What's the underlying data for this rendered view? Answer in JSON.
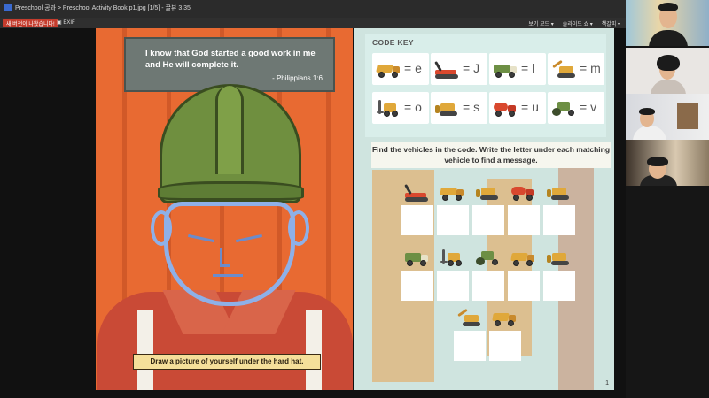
{
  "titlebar": {
    "text": "Preschool 공과 > Preschool Activity Book p1.jpg [1/5] - 꿀뷰 3.35"
  },
  "toolbar": {
    "prev_label": "새 버전이 나왔습니다!",
    "exif_label": "EXIF",
    "menu_view": "보기 모드 ▾",
    "menu_slide": "슬라이드 쇼 ▾",
    "menu_bookmark": "책갈피 ▾"
  },
  "left_page": {
    "verse_text": "I know that God started a good work in me and He will complete it.",
    "verse_ref": "- Philippians 1:6",
    "caption": "Draw a picture of yourself under the hard hat."
  },
  "right_page": {
    "code_key_title": "CODE KEY",
    "keys": [
      {
        "vehicle": "dump-truck",
        "letter": "= e"
      },
      {
        "vehicle": "crane",
        "letter": "= J"
      },
      {
        "vehicle": "garbage-truck",
        "letter": "= l"
      },
      {
        "vehicle": "excavator",
        "letter": "= m"
      },
      {
        "vehicle": "forklift",
        "letter": "= o"
      },
      {
        "vehicle": "bulldozer",
        "letter": "= s"
      },
      {
        "vehicle": "cement-mixer",
        "letter": "= u"
      },
      {
        "vehicle": "road-roller",
        "letter": "= v"
      }
    ],
    "instructions": "Find the vehicles in the code. Write the letter under each matching vehicle to find a message.",
    "page_number": "1",
    "puzzle_rows": [
      [
        "crane",
        "dump-truck",
        "bulldozer",
        "cement-mixer",
        "bulldozer"
      ],
      [
        "garbage-truck",
        "forklift",
        "road-roller",
        "dump-truck",
        "bulldozer"
      ],
      [
        "excavator",
        "dump-truck"
      ]
    ]
  },
  "colors": {
    "page_orange": "#e86a32",
    "page_mint": "#cfe4df",
    "helmet_green": "#6f8f3f",
    "sketch_blue": "#8eb0e8",
    "vehicle_yellow": "#e0a83a",
    "vehicle_red": "#d9482e",
    "vehicle_green": "#6d8f44"
  },
  "video_participants": [
    "participant-1",
    "participant-2",
    "participant-3",
    "participant-4"
  ]
}
